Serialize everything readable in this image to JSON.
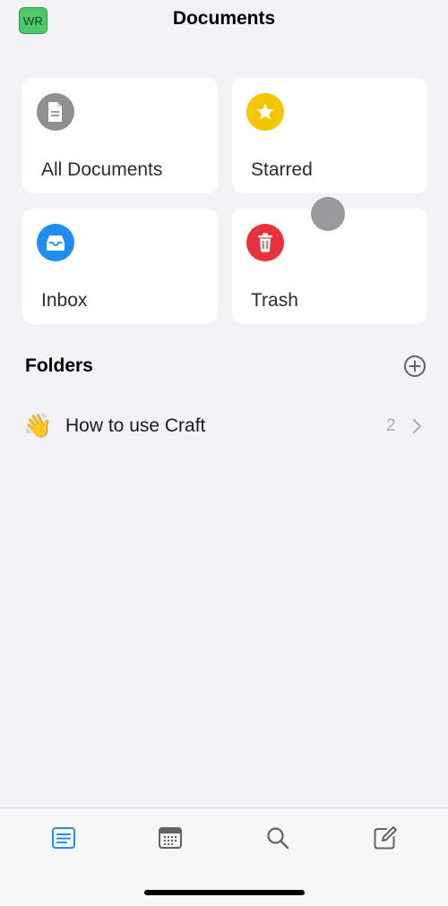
{
  "header": {
    "avatar_initials": "WR",
    "title": "Documents"
  },
  "cards": [
    {
      "label": "All Documents",
      "icon": "document-icon",
      "color": "#8e8e93"
    },
    {
      "label": "Starred",
      "icon": "star-icon",
      "color": "#f5c500"
    },
    {
      "label": "Inbox",
      "icon": "inbox-tray-icon",
      "color": "#1e8ff1"
    },
    {
      "label": "Trash",
      "icon": "trash-icon",
      "color": "#e8323c"
    }
  ],
  "folders": {
    "title": "Folders",
    "add_icon": "plus-circle-icon",
    "items": [
      {
        "emoji": "👋",
        "name": "How to use Craft",
        "count": "2"
      }
    ]
  },
  "tabbar": {
    "items": [
      {
        "icon": "documents-icon",
        "active": true
      },
      {
        "icon": "calendar-icon",
        "active": false
      },
      {
        "icon": "search-icon",
        "active": false
      },
      {
        "icon": "compose-icon",
        "active": false
      }
    ],
    "active_color": "#1e8ff1"
  }
}
